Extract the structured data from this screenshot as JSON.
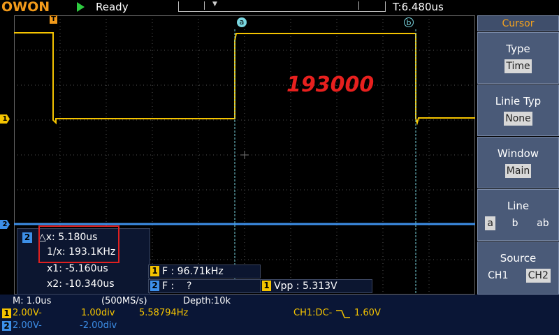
{
  "header": {
    "logo": "OWON",
    "status": "Ready",
    "trigger_time": "T:6.480us"
  },
  "colors": {
    "ch1": "#f5c400",
    "ch2": "#3d8fe8",
    "cursor_a": "#7ad6e0",
    "cursor_b": "#7ad6e0",
    "accent": "#f4a21e",
    "highlight": "#e02020"
  },
  "waveform": {
    "overlay_text": "193000",
    "cursor_a_label": "a",
    "cursor_b_label": "b",
    "trigger_marker": "T",
    "ch1_marker": "1",
    "ch2_marker": "2"
  },
  "cursor_readout": {
    "channel": "2",
    "delta_x": "△x: 5.180us",
    "inv_x": "1/x: 193.1KHz",
    "x1": "x1: -5.160us",
    "x2": "x2: -10.340us"
  },
  "measurements": {
    "ch1_freq": {
      "channel": "1",
      "text": "F : 96.71kHz"
    },
    "ch2_freq": {
      "channel": "2",
      "text": "F :    ?"
    },
    "ch1_vpp": {
      "channel": "1",
      "text": "Vpp : 5.313V"
    }
  },
  "side_panel": {
    "title": "Cursor",
    "type": {
      "label": "Type",
      "value": "Time"
    },
    "line_type": {
      "label": "Linie Typ",
      "value": "None"
    },
    "window": {
      "label": "Window",
      "value": "Main"
    },
    "line": {
      "label": "Line",
      "options": [
        "a",
        "b",
        "ab"
      ],
      "selected": "a"
    },
    "source": {
      "label": "Source",
      "options": [
        "CH1",
        "CH2"
      ],
      "selected": "CH2"
    }
  },
  "bottom_bar": {
    "timebase": "M: 1.0us",
    "sample_rate": "(500MS/s)",
    "depth": "Depth:10k",
    "ch1": {
      "badge": "1",
      "volts": "2.00V-",
      "pos": "1.00div",
      "freq": "5.58794Hz"
    },
    "ch2": {
      "badge": "2",
      "volts": "2.00V-",
      "pos": "-2.00div"
    },
    "trigger": "CH1:DC-",
    "trigger_level": "1.60V"
  }
}
